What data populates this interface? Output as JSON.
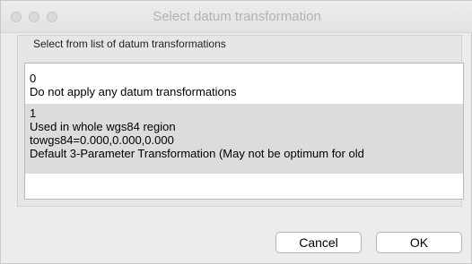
{
  "window": {
    "title": "Select datum transformation"
  },
  "group": {
    "label": "Select from list of datum transformations"
  },
  "list": {
    "items": [
      {
        "lines": [
          "0",
          "Do not apply any datum transformations"
        ],
        "selected": false
      },
      {
        "lines": [
          "1",
          "Used in whole wgs84 region",
          "towgs84=0.000,0.000,0.000",
          "Default 3-Parameter Transformation (May not be optimum for old"
        ],
        "selected": true
      }
    ]
  },
  "buttons": {
    "cancel_label": "Cancel",
    "ok_label": "OK"
  },
  "colors": {
    "window_bg": "#ececec",
    "selection_bg": "#dcdcdc",
    "title_text": "#b3b3b3"
  }
}
